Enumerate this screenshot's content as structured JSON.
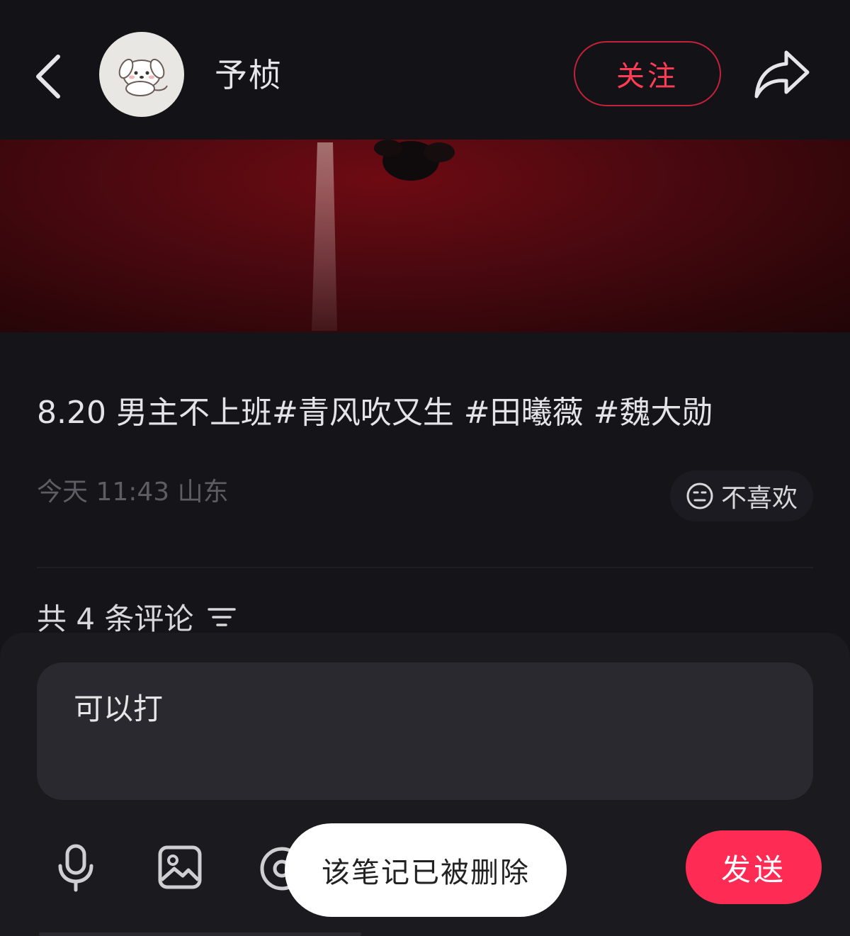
{
  "header": {
    "author_name": "予桢",
    "follow_label": "关注"
  },
  "post": {
    "title": "8.20 男主不上班#青风吹又生 #田曦薇 #魏大勋",
    "date": "今天 11:43",
    "location": "山东",
    "dislike_label": "不喜欢"
  },
  "comments": {
    "count_label": "共 4 条评论"
  },
  "composer": {
    "input_text": "可以打",
    "send_label": "发送"
  },
  "toast": {
    "message": "该笔记已被删除"
  },
  "colors": {
    "accent": "#fe2c55",
    "follow_text": "#ff3b55",
    "background": "#141419"
  },
  "icons": [
    "back-arrow-icon",
    "share-icon",
    "neutral-face-icon",
    "sort-filter-icon",
    "microphone-icon",
    "image-icon",
    "at-icon"
  ]
}
